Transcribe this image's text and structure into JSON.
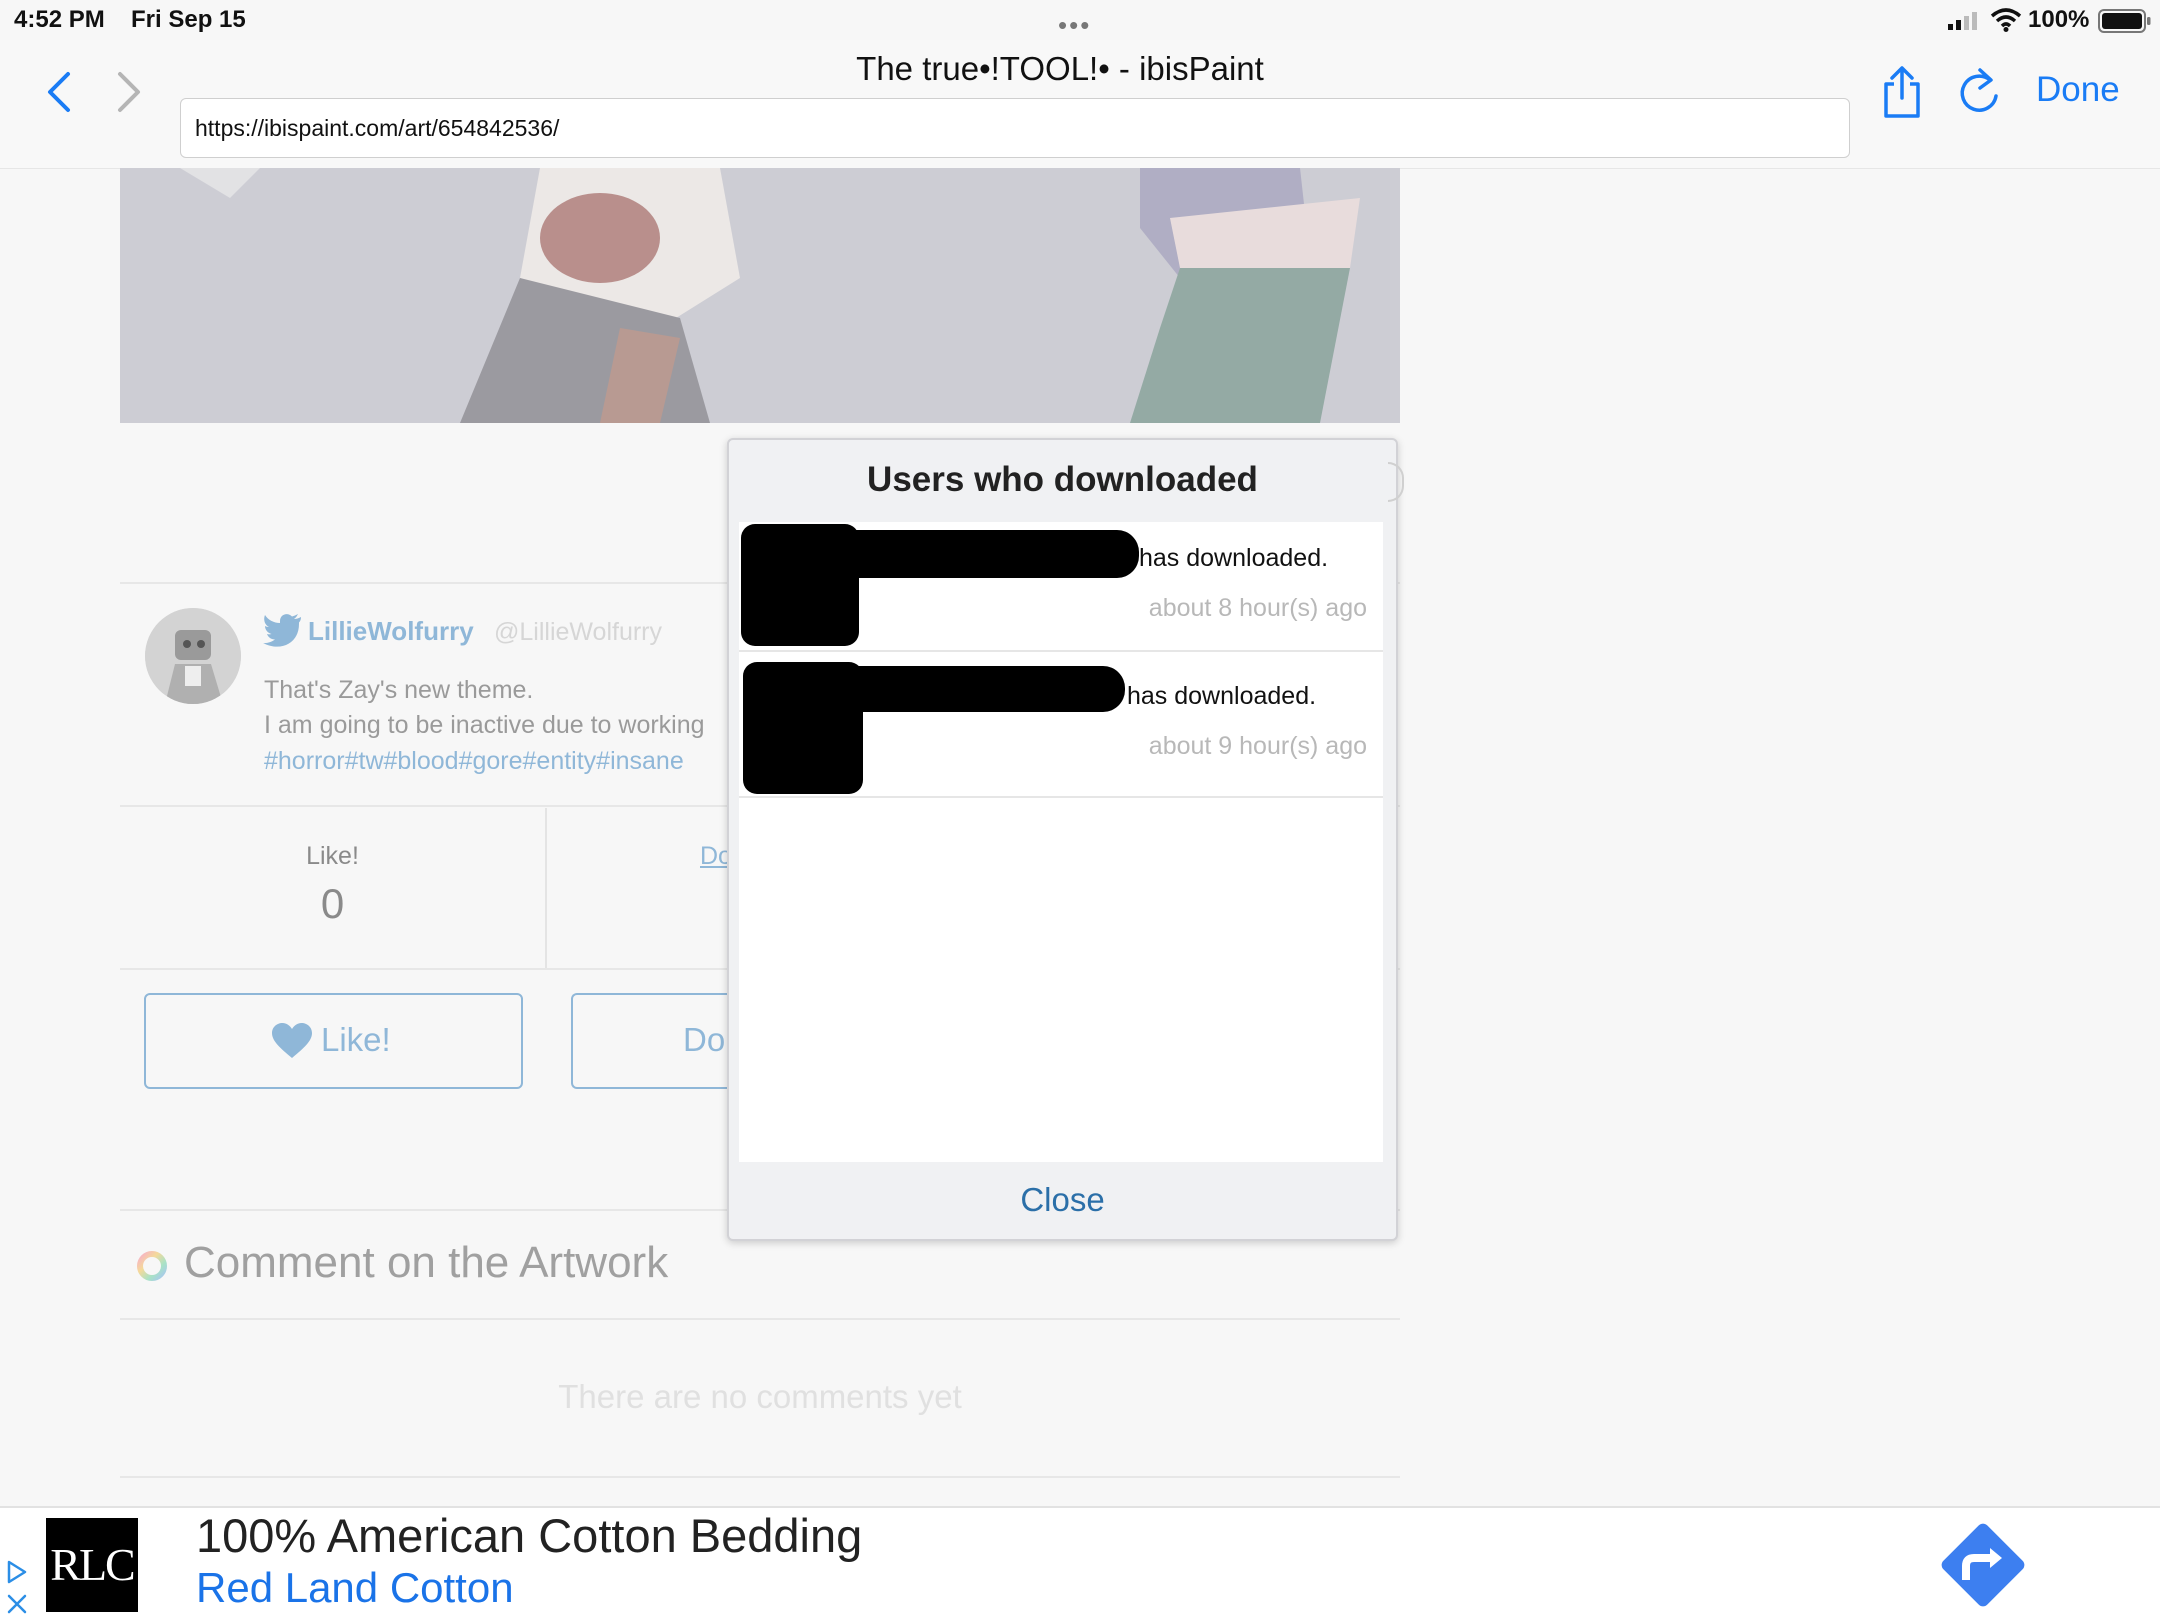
{
  "status_bar": {
    "time": "4:52 PM",
    "date": "Fri Sep 15",
    "battery": "100%"
  },
  "browser": {
    "title": "The true•!TOOL!• - ibisPaint",
    "url": "https://ibispaint.com/art/654842536/",
    "done_label": "Done"
  },
  "artwork": {
    "author_name": "LillieWolfurry",
    "author_handle": "@LillieWolfurry",
    "description_line1": "That's Zay's new theme.",
    "description_line2": "I am going to be inactive due to working",
    "tags": "#horror#tw#blood#gore#entity#insane"
  },
  "stats": {
    "like_label": "Like!",
    "like_count": "0",
    "download_link": "Do"
  },
  "buttons": {
    "like_label": "Like!",
    "download_label": "Do"
  },
  "comments": {
    "heading": "Comment on the Artwork",
    "empty_text": "There are no comments yet"
  },
  "modal": {
    "title": "Users who downloaded",
    "rows": [
      {
        "text": "has downloaded.",
        "time": "about 8 hour(s) ago"
      },
      {
        "text": "has downloaded.",
        "time": "about 9 hour(s) ago"
      }
    ],
    "close_label": "Close"
  },
  "ad": {
    "logo_text": "RLC",
    "headline": "100% American Cotton Bedding",
    "brand": "Red Land Cotton",
    "accent_color": "#1a73e8"
  },
  "colors": {
    "link_blue": "#1a7cf5",
    "muted_blue": "#8fb7d8",
    "modal_close": "#2b6fa8"
  }
}
